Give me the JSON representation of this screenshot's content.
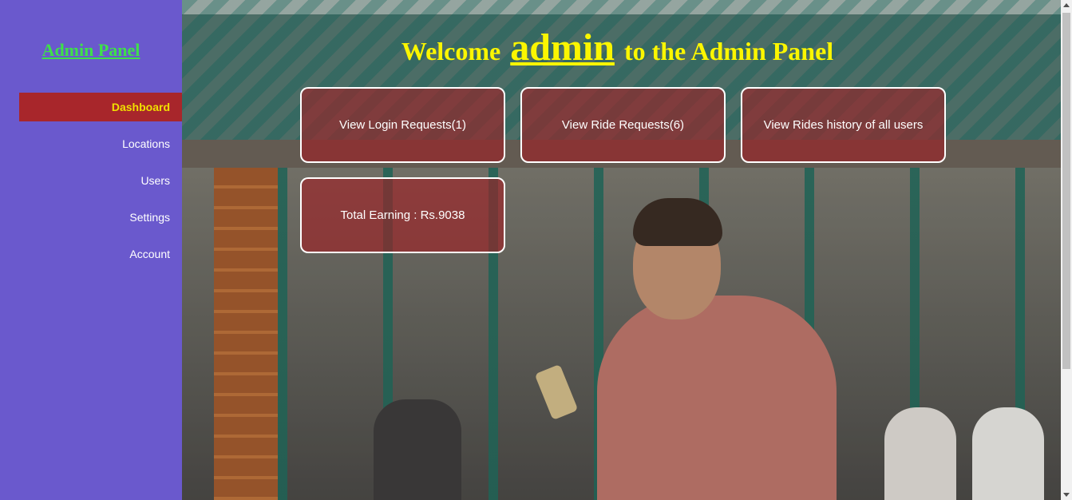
{
  "sidebar": {
    "brand": "Admin Panel",
    "items": [
      {
        "label": "Dashboard"
      },
      {
        "label": "Locations"
      },
      {
        "label": "Users"
      },
      {
        "label": "Settings"
      },
      {
        "label": "Account"
      }
    ]
  },
  "header": {
    "welcome_prefix": "Welcome",
    "username": "admin",
    "welcome_suffix": "to the Admin Panel"
  },
  "cards": [
    {
      "label": "View Login Requests(1)"
    },
    {
      "label": "View Ride Requests(6)"
    },
    {
      "label": "View Rides history of all users"
    },
    {
      "label": "Total Earning : Rs.9038"
    }
  ],
  "colors": {
    "sidebar_bg": "#6a59cd",
    "brand": "#3ee04a",
    "active_bg": "#a8262b",
    "active_text": "#f1e000",
    "heading": "#fbf600"
  }
}
